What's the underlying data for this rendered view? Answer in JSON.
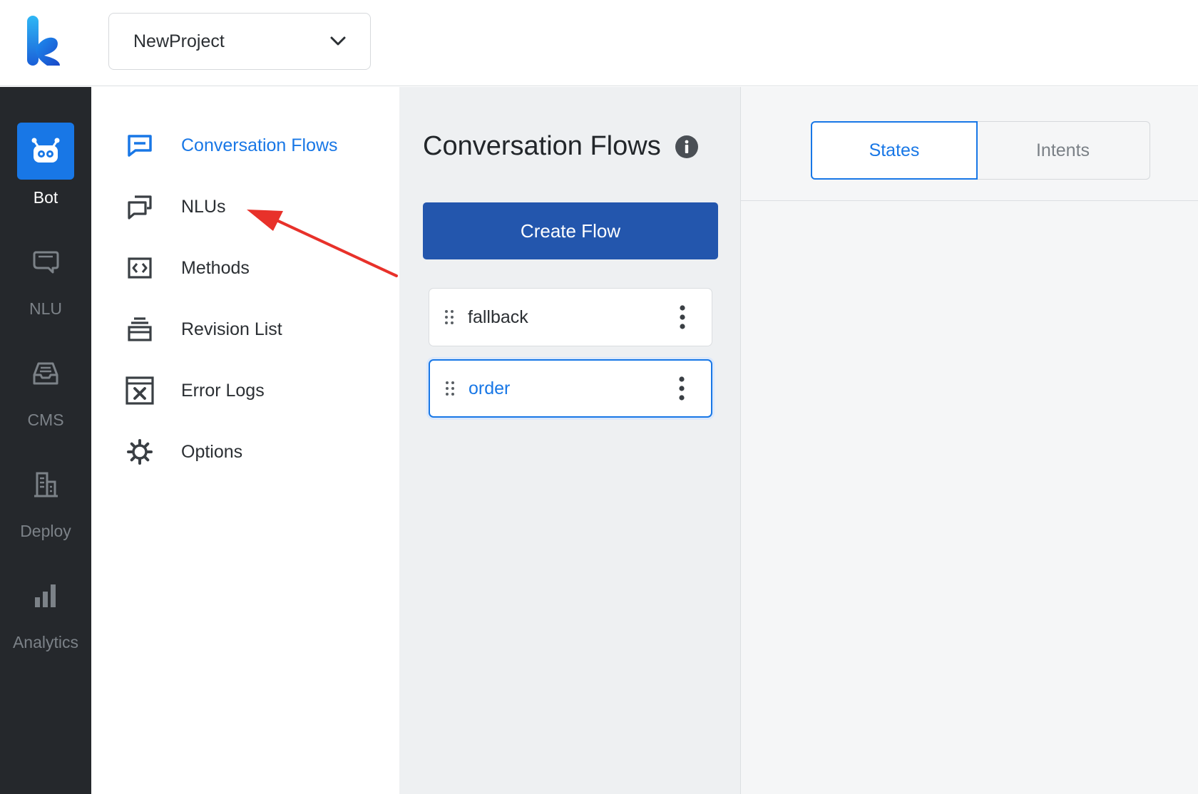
{
  "header": {
    "project_name": "NewProject"
  },
  "rail": {
    "items": [
      {
        "label": "Bot",
        "icon": "bot-icon",
        "active": true
      },
      {
        "label": "NLU",
        "icon": "chat-bubble-icon"
      },
      {
        "label": "CMS",
        "icon": "inbox-icon"
      },
      {
        "label": "Deploy",
        "icon": "building-icon"
      },
      {
        "label": "Analytics",
        "icon": "bar-chart-icon"
      }
    ]
  },
  "nav": {
    "items": [
      {
        "label": "Conversation Flows",
        "icon": "message-square-icon",
        "active": true
      },
      {
        "label": "NLUs",
        "icon": "stacked-chats-icon"
      },
      {
        "label": "Methods",
        "icon": "code-icon"
      },
      {
        "label": "Revision List",
        "icon": "stack-icon"
      },
      {
        "label": "Error Logs",
        "icon": "error-window-icon"
      },
      {
        "label": "Options",
        "icon": "gear-icon"
      }
    ]
  },
  "flows_panel": {
    "title": "Conversation Flows",
    "create_button": "Create Flow",
    "flows": [
      {
        "name": "fallback",
        "selected": false
      },
      {
        "name": "order",
        "selected": true
      }
    ]
  },
  "detail": {
    "tabs": [
      {
        "label": "States",
        "active": true
      },
      {
        "label": "Intents",
        "active": false
      }
    ]
  },
  "colors": {
    "accent": "#1877e6",
    "primary_button": "#2356ad",
    "rail_bg": "#25282c",
    "annotation_arrow": "#e8312a"
  }
}
